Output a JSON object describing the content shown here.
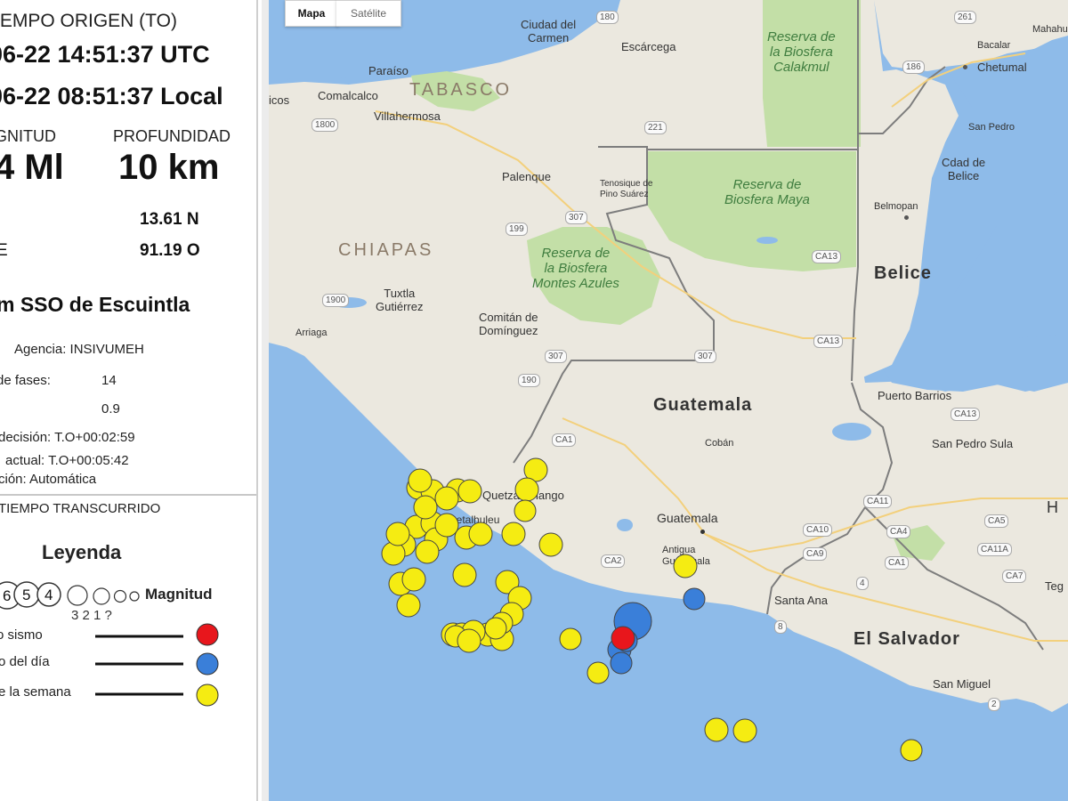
{
  "info": {
    "origin_header": "IEMPO ORIGEN (TO)",
    "utc_time": "06-22 14:51:37 UTC",
    "local_time": "06-22 08:51:37 Local",
    "magnitude_label": "GNITUD",
    "depth_label": "PROFUNDIDAD",
    "magnitude_value": "4 Ml",
    "depth_value": "10 km",
    "lat_label": "",
    "lon_label": "E",
    "latitude": "13.61 N",
    "longitude": "91.19 O",
    "place": "m SSO de Escuintla",
    "agency": "Agencia: INSIVUMEH",
    "phases_label": "de fases:",
    "phases_value": "14",
    "rms_value": "0.9",
    "decision_time": "decisión: T.O+00:02:59",
    "current_time": "actual: T.O+00:05:42",
    "solution": "ción: Automática"
  },
  "legend": {
    "elapsed": "TIEMPO TRANSCURRIDO",
    "title": "Leyenda",
    "magnitude_label": "Magnitud",
    "circle_numbers": [
      "6",
      "5",
      "4"
    ],
    "small_numbers": "3  2  1  ?",
    "rows": [
      {
        "label": "o sismo",
        "color": "#e8161c"
      },
      {
        "label": "o del día",
        "color": "#3a7fd9"
      },
      {
        "label": "e la semana",
        "color": "#f5ec12"
      }
    ]
  },
  "map": {
    "map_type_buttons": [
      "Mapa",
      "Satélite"
    ],
    "countries": [
      "Guatemala",
      "Belice",
      "El Salvador"
    ],
    "states": [
      "TABASCO",
      "CHIAPAS"
    ],
    "parks": [
      [
        "Reserva de",
        "la Biosfera",
        "Calakmul"
      ],
      [
        "Reserva de",
        "Biosfera Maya"
      ],
      [
        "Reserva de",
        "la Biosfera",
        "Montes Azules"
      ]
    ],
    "cities": {
      "ciudad_carmen": "Ciudad del\nCarmen",
      "escarcega": "Escárcega",
      "paraiso": "Paraíso",
      "comalcalco": "Comalcalco",
      "villahermosa": "Villahermosa",
      "palenque": "Palenque",
      "tenosique": "Tenosique de\nPino Suárez",
      "tuxtla": "Tuxtla\nGutiérrez",
      "comitan": "Comitán de\nDomínguez",
      "arriaga": "Arriaga",
      "chetumal": "Chetumal",
      "bacalar": "Bacalar",
      "san_pedro_belice": "San Pedro",
      "cdad_belice": "Cdad de\nBelice",
      "belmopan": "Belmopan",
      "puerto_barrios": "Puerto Barrios",
      "san_pedro_sula": "San Pedro Sula",
      "quetzaltenango": "Quetzaltenango",
      "coban": "Cobán",
      "guatemala_city": "Guatemala",
      "antigua": "Antigua\nGuatemala",
      "santa_ana": "Santa Ana",
      "san_miguel": "San Miguel",
      "retalhuleu": "Retalhuleu",
      "mahahual": "Mahahual",
      "icos": "icos",
      "h_edge": "H",
      "teg_edge": "Teg"
    },
    "road_shields": [
      "180",
      "186",
      "261",
      "221",
      "1800",
      "307",
      "199",
      "307",
      "1900",
      "307",
      "190",
      "CA1",
      "CA2",
      "CA10",
      "CA9",
      "CA11",
      "CA4",
      "CA5",
      "CA11A",
      "CA7",
      "CA13",
      "CA13",
      "CA13",
      "4",
      "8",
      "2",
      "CA1"
    ],
    "colors": {
      "ocean": "#8ebbe9",
      "land": "#ebe8df",
      "park": "#c3dfa7",
      "border": "#7d7d7d",
      "quake_latest": "#e8161c",
      "quake_day": "#3a7fd9",
      "quake_week": "#f5ec12"
    }
  },
  "chart_data": {
    "type": "scatter",
    "description_units": "map pixel positions are layout; values are magnitude class per event",
    "series": [
      {
        "name": "Último sismo",
        "color": "#e8161c",
        "magnitudes": [
          4
        ]
      },
      {
        "name": "Sismos del día",
        "color": "#3a7fd9",
        "magnitudes": [
          5,
          4,
          3,
          3,
          3
        ]
      },
      {
        "name": "Sismos de la semana",
        "color": "#f5ec12",
        "magnitudes": [
          4,
          4,
          4,
          4,
          4,
          4,
          3,
          4,
          4,
          4,
          4,
          4,
          4,
          4,
          4,
          4,
          4,
          4,
          4,
          4,
          4,
          4,
          4,
          4,
          4,
          4,
          4,
          3,
          4,
          4,
          4,
          3,
          3,
          4,
          4,
          4,
          4,
          4,
          3,
          4,
          4,
          4,
          3,
          3
        ]
      }
    ]
  }
}
